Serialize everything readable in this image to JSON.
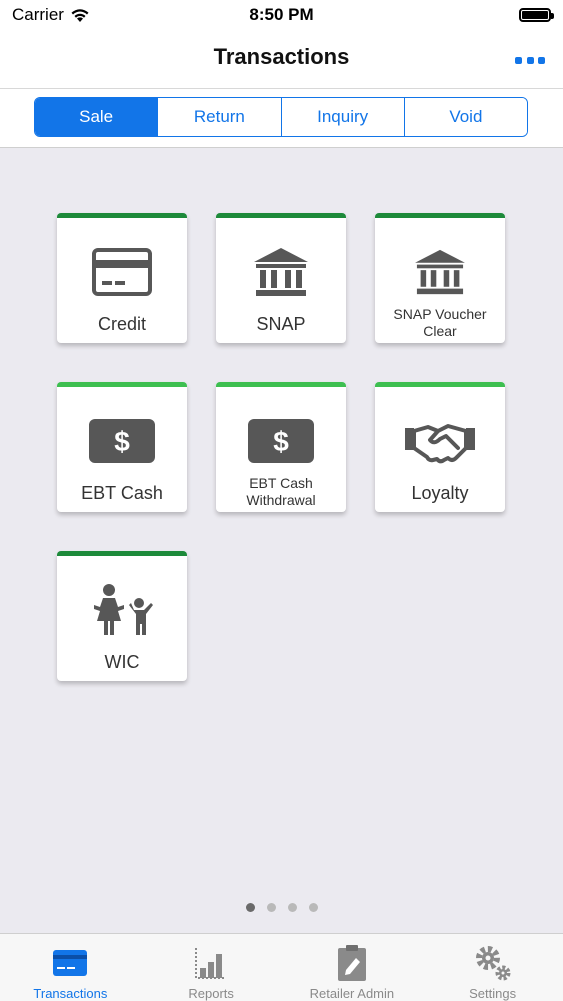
{
  "status_bar": {
    "carrier": "Carrier",
    "time": "8:50 PM"
  },
  "nav": {
    "title": "Transactions",
    "more_icon": "ellipsis-icon"
  },
  "segments": [
    {
      "label": "Sale",
      "active": true
    },
    {
      "label": "Return",
      "active": false
    },
    {
      "label": "Inquiry",
      "active": false
    },
    {
      "label": "Void",
      "active": false
    }
  ],
  "tiles": [
    {
      "label": "Credit",
      "icon": "credit-card-icon"
    },
    {
      "label": "SNAP",
      "icon": "bank-icon"
    },
    {
      "label": "SNAP Voucher Clear",
      "icon": "bank-icon"
    },
    {
      "label": "EBT Cash",
      "icon": "dollar-icon"
    },
    {
      "label": "EBT Cash Withdrawal",
      "icon": "dollar-icon"
    },
    {
      "label": "Loyalty",
      "icon": "handshake-icon"
    },
    {
      "label": "WIC",
      "icon": "mother-child-icon"
    }
  ],
  "page_indicator": {
    "pages": 4,
    "current": 1
  },
  "tab_bar": [
    {
      "label": "Transactions",
      "icon": "card-icon",
      "active": true
    },
    {
      "label": "Reports",
      "icon": "bar-chart-icon",
      "active": false
    },
    {
      "label": "Retailer Admin",
      "icon": "clipboard-icon",
      "active": false
    },
    {
      "label": "Settings",
      "icon": "gears-icon",
      "active": false
    }
  ],
  "colors": {
    "accent": "#1275e8",
    "tile_border_dark": "#1d8a3a",
    "tile_border_light": "#3dbf50",
    "icon_gray": "#575757",
    "background": "#ebeaf0"
  }
}
